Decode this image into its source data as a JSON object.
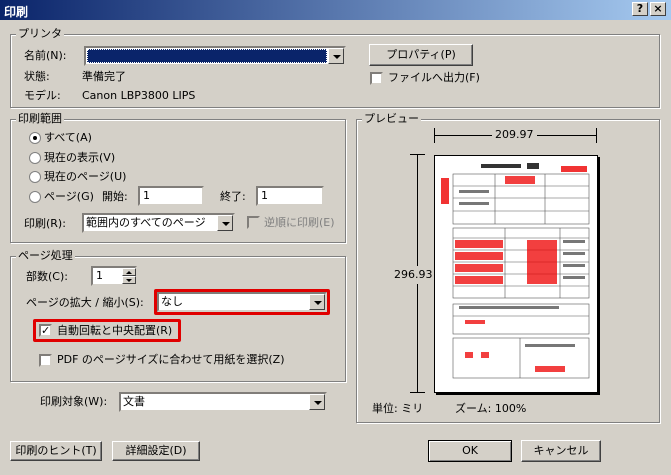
{
  "window": {
    "title": "印刷",
    "help": "?",
    "close": "×"
  },
  "printer": {
    "group_label": "プリンタ",
    "name_label": "名前(N):",
    "name_value": "",
    "properties_button": "プロパティ(P)",
    "print_to_file_label": "ファイルへ出力(F)",
    "status_label": "状態:",
    "status_value": "準備完了",
    "model_label": "モデル:",
    "model_value": "Canon LBP3800 LIPS"
  },
  "range": {
    "group_label": "印刷範囲",
    "all_label": "すべて(A)",
    "current_view_label": "現在の表示(V)",
    "current_page_label": "現在のページ(U)",
    "pages_label": "ページ(G)",
    "start_label": "開始:",
    "start_value": "1",
    "end_label": "終了:",
    "end_value": "1",
    "print_label": "印刷(R):",
    "print_value": "範囲内のすべてのページ",
    "reverse_label": "逆順に印刷(E)"
  },
  "handling": {
    "group_label": "ページ処理",
    "copies_label": "部数(C):",
    "copies_value": "1",
    "scaling_label": "ページの拡大 / 縮小(S):",
    "scaling_value": "なし",
    "autorotate_label": "自動回転と中央配置(R)",
    "pdf_size_label": "PDF のページサイズに合わせて用紙を選択(Z)"
  },
  "what": {
    "label": "印刷対象(W):",
    "value": "文書"
  },
  "preview": {
    "group_label": "プレビュー",
    "width": "209.97",
    "height": "296.93",
    "units": "単位: ミリ",
    "zoom": "ズーム: 100%"
  },
  "footer": {
    "tips_button": "印刷のヒント(T)",
    "advanced_button": "詳細設定(D)",
    "ok_button": "OK",
    "cancel_button": "キャンセル"
  }
}
